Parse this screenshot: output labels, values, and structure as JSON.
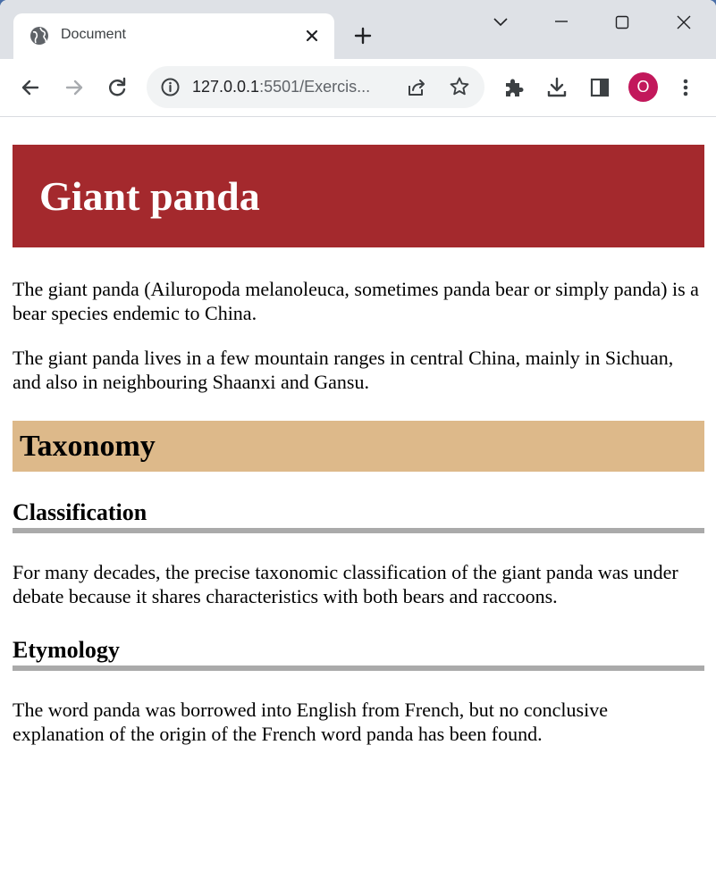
{
  "browser": {
    "tab_title": "Document",
    "url_host": "127.0.0.1",
    "url_rest": ":5501/Exercis...",
    "profile_initial": "O"
  },
  "page": {
    "title": "Giant panda",
    "intro_paragraphs": [
      "The giant panda (Ailuropoda melanoleuca, sometimes panda bear or simply panda) is a bear species endemic to China.",
      "The giant panda lives in a few mountain ranges in central China, mainly in Sichuan, and also in neighbouring Shaanxi and Gansu."
    ],
    "section": {
      "title": "Taxonomy",
      "subsections": [
        {
          "title": "Classification",
          "text": "For many decades, the precise taxonomic classification of the giant panda was under debate because it shares characteristics with both bears and raccoons."
        },
        {
          "title": "Etymology",
          "text": "The word panda was borrowed into English from French, but no conclusive explanation of the origin of the French word panda has been found."
        }
      ]
    }
  },
  "colors": {
    "banner": "#a4292d",
    "section_bar": "#ddb98a",
    "rule": "#aaaaaa",
    "avatar": "#c2185b"
  },
  "icons": {
    "tab_favicon": "globe-icon",
    "tab_close": "close-icon",
    "new_tab": "plus-icon",
    "back": "back-arrow-icon",
    "forward": "forward-arrow-icon",
    "reload": "reload-icon",
    "site_info": "info-icon",
    "share": "share-icon",
    "bookmark": "star-icon",
    "extensions": "puzzle-icon",
    "downloads": "download-icon",
    "side_panel": "side-panel-icon",
    "menu": "kebab-menu-icon"
  }
}
